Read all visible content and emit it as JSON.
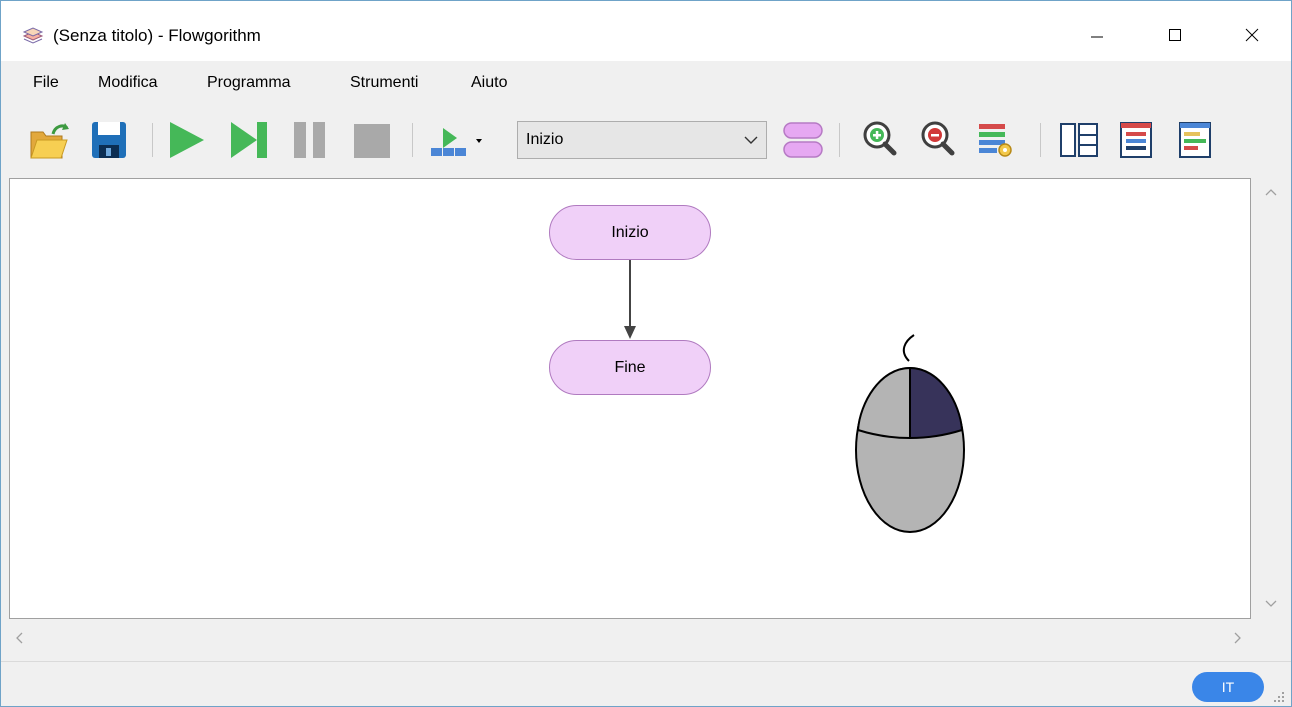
{
  "window": {
    "title": "(Senza titolo) - Flowgorithm",
    "controls": {
      "minimize": "minimize-icon",
      "maximize": "maximize-icon",
      "close": "close-icon"
    }
  },
  "menu": {
    "items": [
      "File",
      "Modifica",
      "Programma",
      "Strumenti",
      "Aiuto"
    ]
  },
  "toolbar": {
    "function_select": {
      "value": "Inizio"
    },
    "icons": [
      "open-folder-icon",
      "save-icon",
      "run-icon",
      "step-icon",
      "pause-icon",
      "stop-icon",
      "run-speed-icon",
      "function-manager-icon",
      "zoom-in-icon",
      "zoom-out-icon",
      "layout-settings-icon",
      "variable-watch-icon",
      "source-viewer-icon",
      "console-icon"
    ]
  },
  "flowchart": {
    "start_label": "Inizio",
    "end_label": "Fine",
    "colors": {
      "terminal_fill": "#f0d0f8",
      "terminal_stroke": "#b07ac0",
      "arrow": "#444444"
    }
  },
  "overlay": {
    "icon": "mouse-right-click-icon",
    "highlight_color": "#37335a",
    "body_color": "#b4b4b4"
  },
  "status": {
    "language": "IT",
    "language_color": "#3a86e8"
  }
}
